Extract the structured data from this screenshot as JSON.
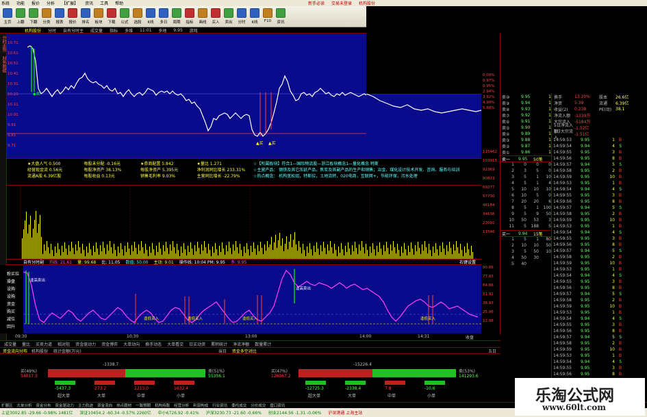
{
  "menu": {
    "items": [
      "系统",
      "功能",
      "报价",
      "分析",
      "【扩展】",
      "资讯",
      "工具",
      "帮助"
    ],
    "right_items": [
      "新手必读",
      "交易未登录",
      "机构股份"
    ]
  },
  "toolbar": {
    "buttons": [
      {
        "label": "主页",
        "color": "#3060c0"
      },
      {
        "label": "上翻",
        "color": "#40a040"
      },
      {
        "label": "下翻",
        "color": "#40a040"
      },
      {
        "label": "分类",
        "color": "#c08020"
      },
      {
        "label": "报表",
        "color": "#3060c0"
      },
      {
        "label": "报价",
        "color": "#c03030"
      },
      {
        "label": "排名",
        "color": "#3060c0"
      },
      {
        "label": "板块",
        "color": "#c08020"
      },
      {
        "label": "下载",
        "color": "#c03030"
      },
      {
        "label": "公式",
        "color": "#40a040"
      },
      {
        "label": "选股",
        "color": "#c08020"
      },
      {
        "label": "K线",
        "color": "#3060c0"
      },
      {
        "label": "多日",
        "color": "#3060c0"
      },
      {
        "label": "周期",
        "color": "#40a040"
      },
      {
        "label": "指标",
        "color": "#c03030"
      },
      {
        "label": "画线",
        "color": "#c08020"
      },
      {
        "label": "买入",
        "color": "#c03030"
      },
      {
        "label": "卖出",
        "color": "#40a040"
      },
      {
        "label": "分时",
        "color": "#3060c0"
      },
      {
        "label": "K线",
        "color": "#3060c0"
      },
      {
        "label": "F10",
        "color": "#c08020"
      },
      {
        "label": "资讯",
        "color": "#40a040"
      }
    ]
  },
  "tabs": [
    "机构股份",
    "分时",
    "自有分时主",
    "成交量",
    "指标",
    "多维",
    "11:01",
    "多地",
    "9.95",
    "游戏"
  ],
  "left_tabs": [
    "分时走势",
    "财务数据"
  ],
  "axis_left": [
    "10.71",
    "10.61",
    "10.51",
    "10.41",
    "10.31",
    "10.21",
    "10.11",
    "10.01",
    "9.91",
    "9.81",
    "9.71"
  ],
  "axis_right": [
    "0.00%",
    "0.97%",
    "0.95%",
    "2.94%",
    "3.92%",
    "4.90%",
    "5.88%",
    "115462",
    "103915",
    "92369",
    "80823",
    "69277",
    "57730",
    "46184",
    "34638",
    "23092",
    "11546"
  ],
  "info": {
    "rows": [
      [
        "★大盘人气 0.500",
        "每股未分配 -0.16元",
        "★券商配置 5.842",
        "★量比 1.271"
      ],
      [
        "经营现金流 0.56元",
        "每股净资产 38.13%",
        "每股净资产 5.395元",
        "净利润同比增长 233.31%"
      ],
      [
        "流通A股 6.39亿股",
        "每股收益 0.13元",
        "销售毛利率 9.03%",
        "主营同比增长 -22.79%"
      ]
    ],
    "concept": [
      "☆【所属板块】符合1—国际物流股—浙江板块概念1—量化概念 特斯",
      "☆主营产品： 钢铁及其它压延产品，焦炭及其副产品的生产和销售；冶金、煤化设计技术开发、咨询、服务与培训",
      "☆热点概念： 机构宽松组，特斯拉，土地流转，020电商，互联网+，节能环保，污水处理"
    ]
  },
  "midbar": {
    "title": "自有分时副",
    "values": [
      "均线: 21.61",
      "量: 99.68",
      "比: 11.05",
      "数值: 50.00",
      "主动: 9.01",
      "操作线: 10:04 PM: 9.95",
      "多: 9.95"
    ],
    "right": "右键设置"
  },
  "indicator": {
    "labels": [
      "粉买拉",
      "操盘",
      "设购",
      "设购",
      "资金",
      "购买",
      "减位",
      "回升"
    ],
    "axis": [
      "90.86",
      "77.83",
      "64.86",
      "51.92",
      "38.93",
      "25.96",
      "12.98"
    ]
  },
  "timeaxis": [
    "09:30",
    "10:30",
    "13:00",
    "14:00",
    "14:31",
    "收盘"
  ],
  "bottom_tabs": [
    "成交量",
    "量比",
    "买卖力道",
    "相对阻",
    "资金驱动力",
    "资金博弈",
    "大单动向",
    "换手动态",
    "大单看交",
    "日买动资",
    "累积统计",
    "净流净额",
    "数量累计"
  ],
  "flow_header": [
    "资金流向分布",
    "机构股份",
    "统计金额(万元)",
    "当日",
    "资金多空对比",
    "五日"
  ],
  "flow": [
    {
      "total": "-1338.7",
      "buy_label": "买(49%)",
      "buy_value": "54017.3",
      "sell_label": "卖(51%)",
      "sell_value": "55356.1",
      "buy_frac": 0.49,
      "mini": [
        {
          "name": "超大单",
          "value": "-5437.3"
        },
        {
          "name": "大单",
          "value": "273.2"
        },
        {
          "name": "中单",
          "value": "2213.0"
        },
        {
          "name": "小单",
          "value": "1632.4"
        }
      ]
    },
    {
      "total": "-15226.4",
      "buy_label": "买(47%)",
      "buy_value": "126067.2",
      "sell_label": "卖(53%)",
      "sell_value": "141293.6",
      "buy_frac": 0.47,
      "mini": [
        {
          "name": "超大单",
          "value": "-12725.3"
        },
        {
          "name": "大单",
          "value": "-2338.4"
        },
        {
          "name": "中单",
          "value": "7.8"
        },
        {
          "name": "小单",
          "value": "-10.6"
        }
      ]
    }
  ],
  "orderbook": {
    "sells": [
      {
        "l": "卖⑩",
        "p": "9.95",
        "v": "1"
      },
      {
        "l": "卖⑨",
        "p": "9.94",
        "v": "1"
      },
      {
        "l": "卖⑧",
        "p": "9.93",
        "v": "1"
      },
      {
        "l": "卖⑦",
        "p": "9.92",
        "v": "1"
      },
      {
        "l": "卖⑥",
        "p": "9.91",
        "v": "1"
      },
      {
        "l": "卖⑤",
        "p": "9.90",
        "v": "1"
      },
      {
        "l": "卖④",
        "p": "9.89",
        "v": "1"
      },
      {
        "l": "卖③",
        "p": "9.88",
        "v": "1"
      },
      {
        "l": "卖②",
        "p": "9.87",
        "v": "1"
      },
      {
        "l": "卖①",
        "p": "9.86",
        "v": "1"
      }
    ],
    "sec_sell": {
      "a": "卖一",
      "b": "9.95",
      "c": "50笔"
    },
    "queue": [
      [
        "1",
        "0",
        "0",
        "0"
      ],
      [
        "2",
        "3",
        "5",
        "0"
      ],
      [
        "3",
        "5",
        "1",
        "10"
      ],
      [
        "4",
        "5",
        "1",
        "4"
      ],
      [
        "5",
        "10",
        "10",
        "10"
      ],
      [
        "6",
        "10",
        "5",
        "0"
      ],
      [
        "7",
        "20",
        "20",
        "6"
      ],
      [
        "8",
        "5",
        "1",
        "100"
      ],
      [
        "9",
        "5",
        "9",
        "50"
      ],
      [
        "10",
        "50",
        "53",
        "3"
      ],
      [
        "11",
        "5",
        "188",
        "5"
      ]
    ],
    "sec_buy": {
      "a": "买一",
      "b": "9.94",
      "c": "15笔"
    },
    "buy_queue": [
      [
        "1",
        "5",
        "1",
        "80"
      ],
      [
        "2",
        "10",
        "10",
        "50"
      ],
      [
        "3",
        "5",
        "50",
        "10"
      ],
      [
        "4",
        "50",
        "30",
        ""
      ],
      [
        "5",
        "40",
        "",
        ""
      ]
    ]
  },
  "stats": [
    {
      "k": "换手",
      "v": "13.20%",
      "k2": "股本",
      "v2": "26.6亿"
    },
    {
      "k": "净资",
      "v": "5.39",
      "k2": "流通",
      "v2": "6.39亿"
    },
    {
      "k": "收益(2)",
      "v": "0.238",
      "k2": "PE(动)",
      "v2": "38.1"
    },
    {
      "k": "净流入额",
      "v": "-1339万",
      "k2": "",
      "v2": ""
    },
    {
      "k": "大宗流入",
      "v": "-5184万",
      "k2": "",
      "v2": ""
    },
    {
      "k": "5日净流入额",
      "v": "-1.52亿",
      "k2": "",
      "v2": ""
    },
    {
      "k": "5日大宗流入",
      "v": "-1.51亿",
      "k2": "",
      "v2": ""
    }
  ],
  "ticks": [
    {
      "t": "14:59:53",
      "p": "9.95",
      "v": "1",
      "f": "B"
    },
    {
      "t": "14:59:54",
      "p": "9.94",
      "v": "4",
      "f": "S"
    },
    {
      "t": "14:59:55",
      "p": "9.95",
      "v": "3",
      "f": "B"
    },
    {
      "t": "14:59:56",
      "p": "9.95",
      "v": "8",
      "f": "B"
    },
    {
      "t": "14:59:57",
      "p": "9.94",
      "v": "5",
      "f": "S"
    },
    {
      "t": "14:59:58",
      "p": "9.95",
      "v": "2",
      "f": "B"
    },
    {
      "t": "14:59:59",
      "p": "9.95",
      "v": "10",
      "f": "B"
    }
  ],
  "status": [
    "扩展区",
    "大单分析",
    "资金分布",
    "资金驱动力",
    "主力轨迹",
    "资金流向",
    "热点题材",
    "一致预期",
    "机构持股",
    "经营分析",
    "利润构成",
    "行业资讯",
    "委托成交",
    "分价成交",
    "盘口资讯"
  ],
  "statusbar": [
    {
      "text": "上证3002.85 -29.66 -0.98% 1481亿",
      "cls": "dn"
    },
    {
      "text": "深证10454.2 -60.34 -0.57% 2260亿",
      "cls": "dn"
    },
    {
      "text": "中小6726.92 -0.41%",
      "cls": "dn"
    },
    {
      "text": "沪深3230.73 -21.60 -0.66%",
      "cls": "dn"
    },
    {
      "text": "创业2144.56 -1.31 -0.06%",
      "cls": "dn"
    },
    {
      "text": "沪深港通 上海主站",
      "cls": "up"
    }
  ],
  "watermark": {
    "line1": "乐淘公式网",
    "line2": "www.60lt.com"
  }
}
